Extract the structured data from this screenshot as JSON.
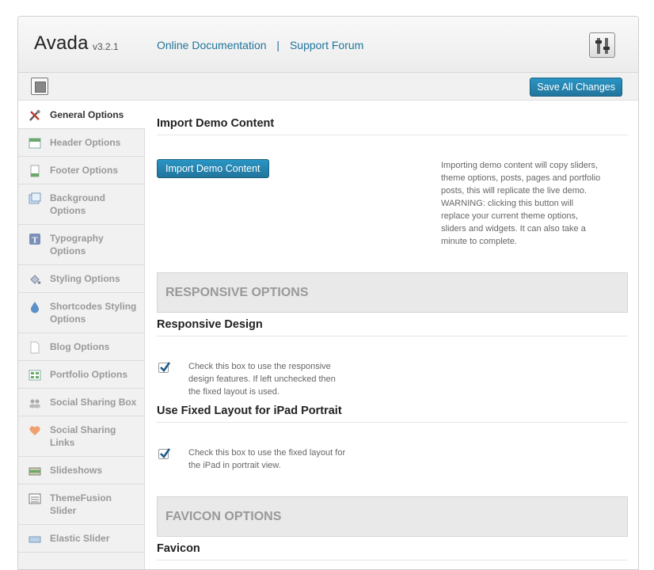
{
  "header": {
    "brand": "Avada",
    "version": "v3.2.1",
    "links": [
      "Online Documentation",
      "Support Forum"
    ],
    "separator": "|"
  },
  "toolbar": {
    "save_label": "Save All Changes"
  },
  "sidebar": {
    "items": [
      {
        "label": "General Options",
        "icon": "wrench-screwdriver-icon",
        "active": true
      },
      {
        "label": "Header Options",
        "icon": "header-layout-icon"
      },
      {
        "label": "Footer Options",
        "icon": "footer-page-icon"
      },
      {
        "label": "Background Options",
        "icon": "background-image-icon"
      },
      {
        "label": "Typography Options",
        "icon": "typography-icon"
      },
      {
        "label": "Styling Options",
        "icon": "paint-bucket-icon"
      },
      {
        "label": "Shortcodes Styling Options",
        "icon": "water-drop-icon"
      },
      {
        "label": "Blog Options",
        "icon": "blog-page-icon"
      },
      {
        "label": "Portfolio Options",
        "icon": "portfolio-grid-icon"
      },
      {
        "label": "Social Sharing Box",
        "icon": "users-icon"
      },
      {
        "label": "Social Sharing Links",
        "icon": "heart-icon"
      },
      {
        "label": "Slideshows",
        "icon": "slideshow-icon"
      },
      {
        "label": "ThemeFusion Slider",
        "icon": "slider-icon"
      },
      {
        "label": "Elastic Slider",
        "icon": "elastic-slider-icon"
      }
    ]
  },
  "main": {
    "import": {
      "title": "Import Demo Content",
      "button": "Import Demo Content",
      "desc_lines": [
        "Importing demo content will copy sliders,",
        "theme options, posts, pages and portfolio",
        "posts, this will replicate the live demo.",
        "WARNING: clicking this button will",
        "replace your current theme options,",
        "sliders and widgets. It can also take a",
        "minute to complete."
      ]
    },
    "responsive_group": "RESPONSIVE OPTIONS",
    "responsive_design": {
      "title": "Responsive Design",
      "checked": true,
      "desc_lines": [
        "Check this box to use the responsive",
        "design features. If left unchecked then",
        "the fixed layout is used."
      ]
    },
    "ipad_layout": {
      "title": "Use Fixed Layout for iPad Portrait",
      "checked": true,
      "desc_lines": [
        "Check this box to use the fixed layout for",
        "the iPad in portrait view."
      ]
    },
    "favicon_group": "FAVICON OPTIONS",
    "favicon_title": "Favicon"
  },
  "colors": {
    "accent": "#21759b",
    "sidebar_bg": "#f1f1f1",
    "group_bg": "#e9e9e9"
  }
}
